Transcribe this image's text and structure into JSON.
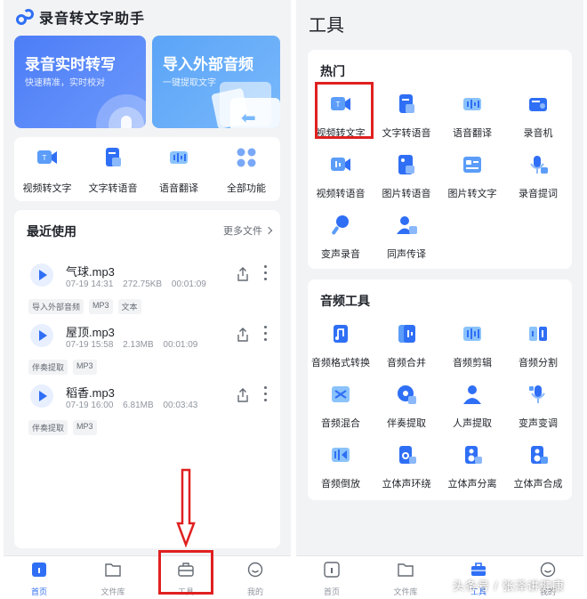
{
  "app": {
    "title": "录音转文字助手"
  },
  "banners": [
    {
      "title": "录音实时转写",
      "subtitle": "快速精准，实时校对"
    },
    {
      "title": "导入外部音频",
      "subtitle": "一键提取文字"
    }
  ],
  "quick_tools": [
    {
      "label": "视频转文字",
      "icon": "video-icon"
    },
    {
      "label": "文字转语音",
      "icon": "document-icon"
    },
    {
      "label": "语音翻译",
      "icon": "audio-translate-icon"
    },
    {
      "label": "全部功能",
      "icon": "grid-icon"
    }
  ],
  "recent": {
    "title": "最近使用",
    "more_label": "更多文件",
    "files": [
      {
        "name": "气球.mp3",
        "date": "07-19 14:31",
        "size": "272.75KB",
        "duration": "00:01:09",
        "tags": [
          "导入外部音频",
          "MP3",
          "文本"
        ]
      },
      {
        "name": "屋顶.mp3",
        "date": "07-19 15:58",
        "size": "2.13MB",
        "duration": "00:01:09",
        "tags": [
          "伴奏提取",
          "MP3"
        ]
      },
      {
        "name": "稻香.mp3",
        "date": "07-19 16:00",
        "size": "6.81MB",
        "duration": "00:03:43",
        "tags": [
          "伴奏提取",
          "MP3"
        ]
      }
    ]
  },
  "nav_left": [
    {
      "label": "首页",
      "icon": "home-icon",
      "active": true
    },
    {
      "label": "文件库",
      "icon": "folder-icon",
      "active": false
    },
    {
      "label": "工具",
      "icon": "toolbox-icon",
      "active": false
    },
    {
      "label": "我的",
      "icon": "smile-icon",
      "active": false
    }
  ],
  "nav_right": [
    {
      "label": "首页",
      "icon": "home-icon",
      "active": false
    },
    {
      "label": "文件库",
      "icon": "folder-icon",
      "active": false
    },
    {
      "label": "工具",
      "icon": "toolbox-icon",
      "active": true
    },
    {
      "label": "我的",
      "icon": "smile-icon",
      "active": false
    }
  ],
  "tools_page": {
    "title": "工具",
    "hot": {
      "title": "热门",
      "items": [
        {
          "label": "视频转文字",
          "icon": "video-icon"
        },
        {
          "label": "文字转语音",
          "icon": "document-icon"
        },
        {
          "label": "语音翻译",
          "icon": "audio-translate-icon"
        },
        {
          "label": "录音机",
          "icon": "recorder-icon"
        },
        {
          "label": "视频转语音",
          "icon": "video-audio-icon"
        },
        {
          "label": "图片转语音",
          "icon": "image-audio-icon"
        },
        {
          "label": "图片转文字",
          "icon": "image-text-icon"
        },
        {
          "label": "录音提词",
          "icon": "teleprompter-icon"
        },
        {
          "label": "变声录音",
          "icon": "voice-change-mic-icon"
        },
        {
          "label": "同声传译",
          "icon": "interpreter-icon"
        }
      ]
    },
    "audio": {
      "title": "音频工具",
      "items": [
        {
          "label": "音频格式转换",
          "icon": "format-convert-icon"
        },
        {
          "label": "音频合并",
          "icon": "audio-merge-icon"
        },
        {
          "label": "音频剪辑",
          "icon": "audio-cut-icon"
        },
        {
          "label": "音频分割",
          "icon": "audio-split-icon"
        },
        {
          "label": "音频混合",
          "icon": "audio-mix-icon"
        },
        {
          "label": "伴奏提取",
          "icon": "accompaniment-icon"
        },
        {
          "label": "人声提取",
          "icon": "vocal-icon"
        },
        {
          "label": "变声变调",
          "icon": "pitch-change-icon"
        },
        {
          "label": "音频倒放",
          "icon": "reverse-icon"
        },
        {
          "label": "立体声环绕",
          "icon": "surround-icon"
        },
        {
          "label": "立体声分离",
          "icon": "stereo-split-icon"
        },
        {
          "label": "立体声合成",
          "icon": "stereo-merge-icon"
        }
      ]
    }
  },
  "watermark": "头条号 / 张泽讲健康",
  "colors": {
    "accent": "#2f6ff5",
    "background": "#f2f3f5",
    "highlight": "#e02020"
  }
}
